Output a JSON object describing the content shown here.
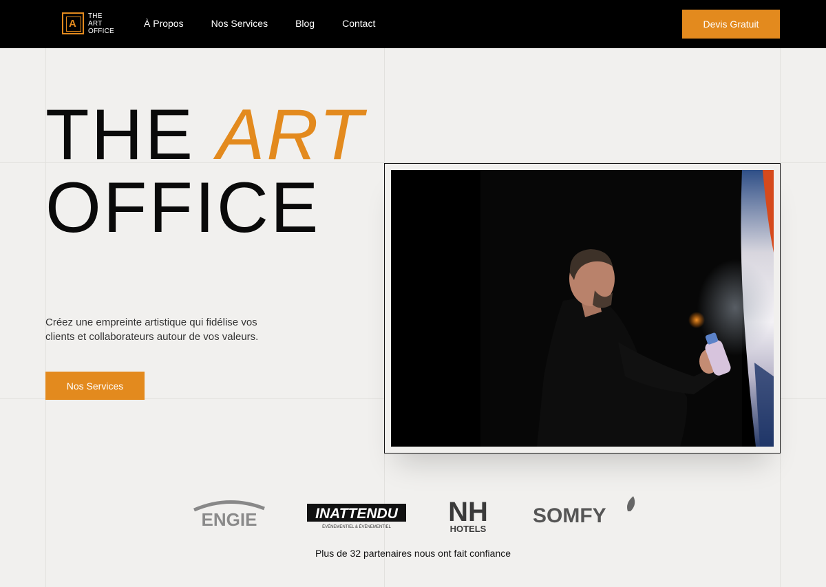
{
  "navbar": {
    "logo_text": [
      "THE",
      "ART",
      "OFFICE"
    ],
    "logo_glyph": "A",
    "links": [
      "À Propos",
      "Nos Services",
      "Blog",
      "Contact"
    ],
    "cta_label": "Devis Gratuit"
  },
  "hero": {
    "title_line1": "THE",
    "title_accent": "ART",
    "title_line2": "OFFICE",
    "description": "Créez une empreinte artistique qui fidélise vos clients et collaborateurs autour de vos valeurs.",
    "button_label": "Nos Services"
  },
  "partners": {
    "logos": [
      {
        "name": "engie",
        "text": "ENGIE"
      },
      {
        "name": "inattendu",
        "text": "INATTENDU",
        "subtext": "ÉVÉNEMENTIEL & ÉVÉNEMENTIEL"
      },
      {
        "name": "nh-hotels",
        "text": "NH",
        "subtext": "HOTELS"
      },
      {
        "name": "somfy",
        "text": "SOMFY"
      }
    ],
    "caption": "Plus de 32 partenaires nous ont fait confiance"
  },
  "colors": {
    "accent": "#e38a1e",
    "navbar_bg": "#000000",
    "page_bg": "#f1f0ee"
  }
}
